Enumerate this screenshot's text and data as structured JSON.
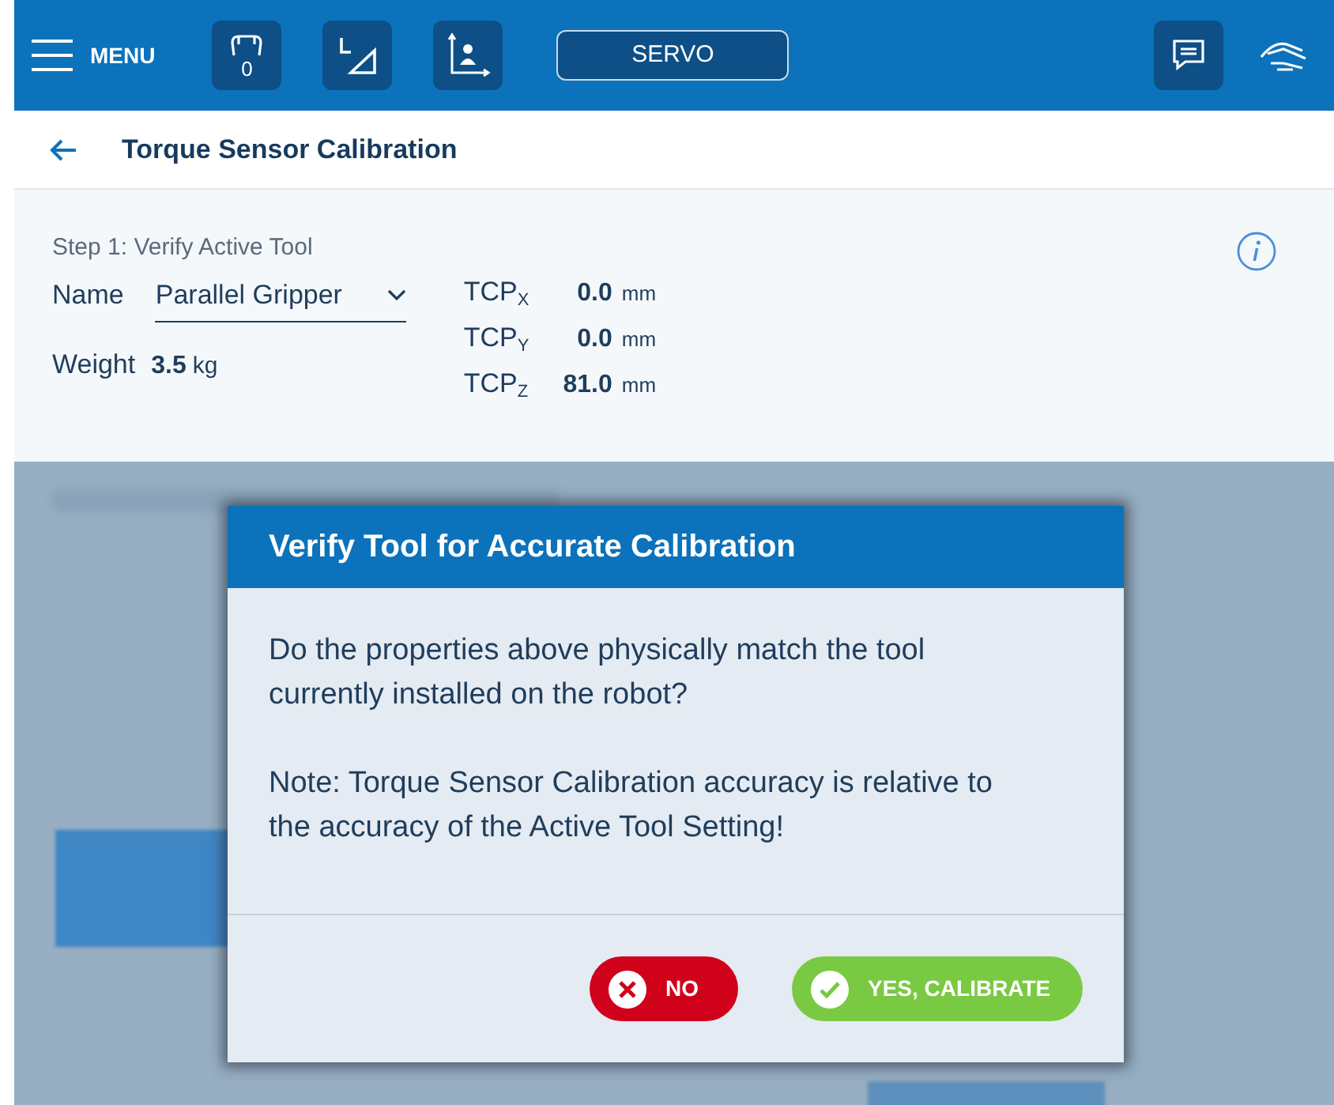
{
  "top_bar": {
    "menu_label": "MENU",
    "gripper_count": "0",
    "servo_label": "SERVO"
  },
  "header": {
    "title": "Torque Sensor Calibration"
  },
  "step1": {
    "title": "Step 1: Verify Active Tool",
    "name_label": "Name",
    "tool_name": "Parallel Gripper",
    "weight_label": "Weight",
    "weight_value": "3.5",
    "weight_unit": "kg",
    "tcp": [
      {
        "label": "TCP$_{X}$",
        "value": "0.0",
        "unit": "mm"
      },
      {
        "label": "TCP$_{Y}$",
        "value": "0.0",
        "unit": "mm"
      },
      {
        "label": "TCP$_{Z}$",
        "value": "81.0",
        "unit": "mm"
      }
    ]
  },
  "dialog": {
    "title": "Verify Tool for Accurate Calibration",
    "question": "Do the properties above physically match the tool currently installed on the robot?",
    "note": "Note: Torque Sensor Calibration accuracy is relative to the accuracy of the Active Tool Setting!",
    "buttons": [
      {
        "kind": "no",
        "label": "NO"
      },
      {
        "kind": "yes",
        "label": "YES, CALIBRATE"
      }
    ]
  }
}
